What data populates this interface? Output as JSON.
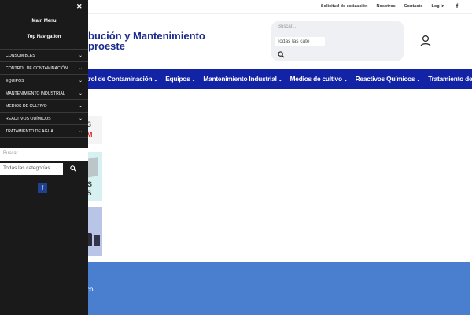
{
  "topbar": {
    "links": [
      "Solicitud de cotización",
      "Nosotros",
      "Contacto",
      "Log in"
    ],
    "social_icon": "facebook-icon"
  },
  "brand": {
    "line1": "bución y Mantenimiento",
    "line2": "proeste"
  },
  "search": {
    "placeholder": "Buscar...",
    "category": "Todas las cate"
  },
  "nav": {
    "items": [
      "trol de Contaminación",
      "Equipos",
      "Mantenimiento Industrial",
      "Medios de cultivo",
      "Reactivos Químicos",
      "Tratamiento de Agua"
    ]
  },
  "banners": {
    "b1_line1": "S",
    "b1_line2": "M",
    "b2_line1": "OS",
    "b2_line2": "AS"
  },
  "footer": {
    "text": "co"
  },
  "drawer": {
    "main_menu": "Main Menu",
    "top_navigation": "Top Navigation",
    "items": [
      "CONSUMIBLES",
      "CONTROL DE CONTAMINACIÓN",
      "EQUIPOS",
      "MANTENIMIENTO INDUSTRIAL",
      "MEDIOS DE CULTIVO",
      "REACTIVOS QUÍMICOS",
      "TRATAMIENTO DE AGUA"
    ],
    "search_placeholder": "Buscar...",
    "category": "Todas las categorías"
  },
  "colors": {
    "nav_blue": "#1223a6",
    "brand_blue": "#1a2a8e",
    "drawer_bg": "#1a1a1a",
    "footer_blue": "#4a7fd0"
  }
}
